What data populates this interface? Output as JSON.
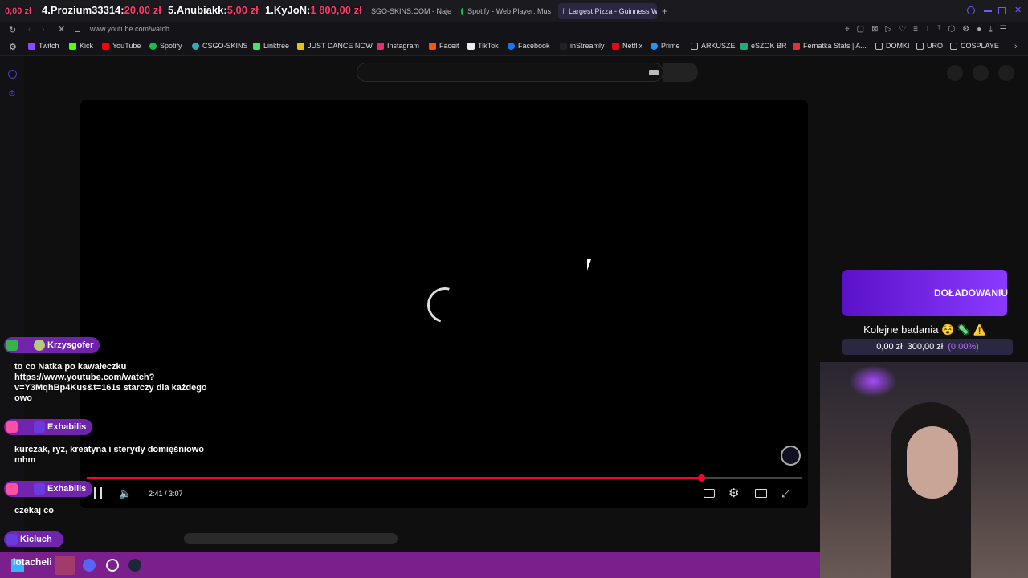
{
  "tabs": [
    {
      "label": "SGO-SKINS.COM - Naje"
    },
    {
      "label": "Spotify - Web Player: Mus"
    },
    {
      "label": "Largest Pizza - Guinness W"
    }
  ],
  "donations": [
    {
      "prefix": "0,00 zł",
      "name": "4.Prozium33314:",
      "amount": "20,00 zł"
    },
    {
      "name": "5.Anubiakk:",
      "amount": "5,00 zł"
    },
    {
      "name": "1.KyJoN:",
      "amount": "1 800,00 zł"
    }
  ],
  "address": {
    "url": "www.youtube.com/watch"
  },
  "bookmarks": [
    "Twitch",
    "Kick",
    "YouTube",
    "Spotify",
    "CSGO-SKINS",
    "Linktree",
    "JUST DANCE NOW",
    "Instagram",
    "Faceit",
    "TikTok",
    "Facebook",
    "inStreamly",
    "Netflix",
    "Prime",
    "ARKUSZE",
    "eSZOK BR",
    "Fernatka Stats | A...",
    "DOMKI",
    "URO",
    "COSPLAYE"
  ],
  "player": {
    "time": "2:41 / 3:07",
    "progress": 0.86
  },
  "chat": [
    {
      "user": "Krzysgofer",
      "text": "to co Natka po kawałeczku https://www.youtube.com/watch?v=Y3MqhBp4Kus&t=161s starczy dla każdego owo"
    },
    {
      "user": "Exhabilis",
      "text": "kurczak, ryż, kreatyna i sterydy domięśniowo mhm"
    },
    {
      "user": "Exhabilis",
      "text": "czekaj co"
    },
    {
      "user": "Kicluch_",
      "text": ""
    }
  ],
  "goal": {
    "banner": "DOŁADOWANIU",
    "title": "Kolejne badania 😵 🦠 ⚠️",
    "current": "0,00 zł",
    "target": "300,00 zł",
    "percent": "(0.00%)"
  },
  "taskbar": {
    "label": "lotacheli"
  },
  "colors": {
    "accent": "#ff0033",
    "brand": "#8a3aff"
  }
}
